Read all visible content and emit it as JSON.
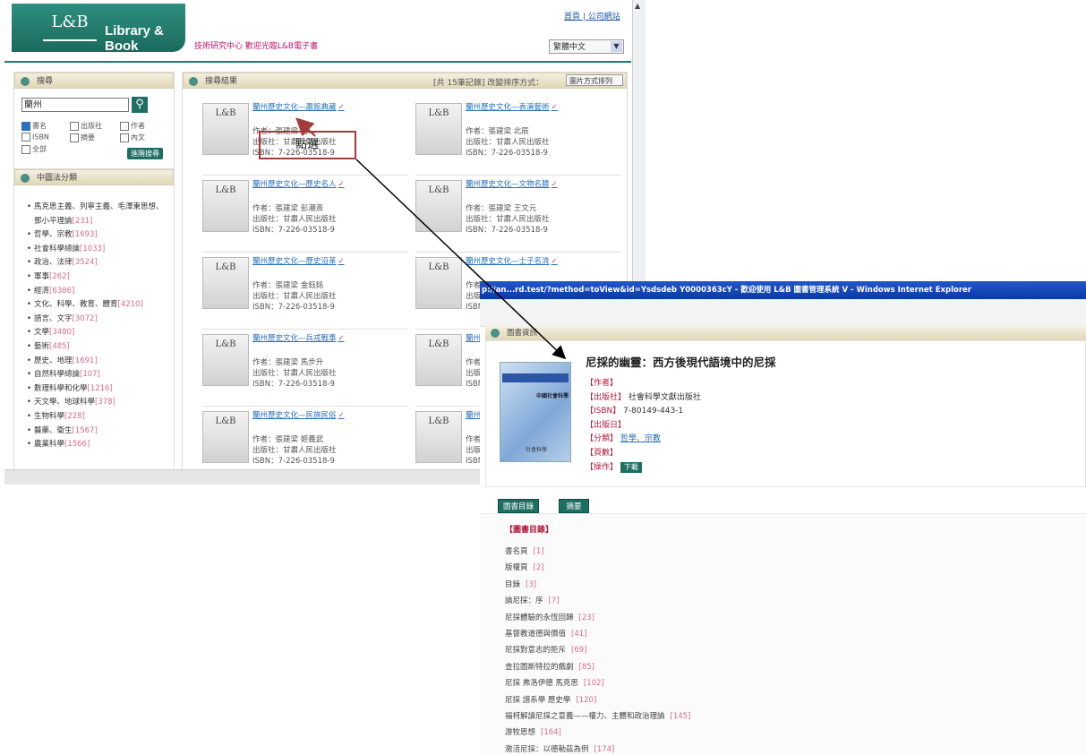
{
  "header": {
    "logo_mark": "L&B",
    "logo_text": "Library & Book",
    "slogan": "技術研究中心 歡迎光臨L&B電子書",
    "top_links": "首頁 | 公司網站",
    "language_selected": "繁體中文"
  },
  "search": {
    "title": "搜尋",
    "input_value": "蘭州",
    "options": [
      "書名",
      "出版社",
      "作者",
      "ISBN",
      "摘要",
      "內文",
      "全部"
    ],
    "advanced_label": "進階搜尋"
  },
  "categories": {
    "title": "中圖法分類",
    "items": [
      {
        "name": "馬克思主義、列寧主義、毛澤東思想、鄧小平理論",
        "count": "[231]"
      },
      {
        "name": "哲學、宗教",
        "count": "[1693]"
      },
      {
        "name": "社會科學總論",
        "count": "[1033]"
      },
      {
        "name": "政治、法律",
        "count": "[3524]"
      },
      {
        "name": "軍事",
        "count": "[262]"
      },
      {
        "name": "經濟",
        "count": "[6386]"
      },
      {
        "name": "文化、科學、教育、體育",
        "count": "[4210]"
      },
      {
        "name": "語言、文字",
        "count": "[3072]"
      },
      {
        "name": "文學",
        "count": "[3480]"
      },
      {
        "name": "藝術",
        "count": "[485]"
      },
      {
        "name": "歷史、地理",
        "count": "[1691]"
      },
      {
        "name": "自然科學總論",
        "count": "[107]"
      },
      {
        "name": "數理科學和化學",
        "count": "[1216]"
      },
      {
        "name": "天文學、地球科學",
        "count": "[378]"
      },
      {
        "name": "生物科學",
        "count": "[228]"
      },
      {
        "name": "醫藥、衛生",
        "count": "[1567]"
      },
      {
        "name": "農業科學",
        "count": "[1566]"
      }
    ]
  },
  "results": {
    "title": "搜尋結果",
    "sort_info": "[共 15筆記錄] 改變排序方式：",
    "sort_selected": "圖片方式排列",
    "books": [
      {
        "cover": "L&B",
        "title": "蘭州歷史文化—蕭館典藏",
        "author": "作者：張建梁 趙...",
        "publisher": "出版社：甘肅人民出版社",
        "isbn": "ISBN：7-226-03518-9"
      },
      {
        "cover": "L&B",
        "title": "蘭州歷史文化—表演藝術",
        "author": "作者：張建梁 北辰",
        "publisher": "出版社：甘肅人民出版社",
        "isbn": "ISBN：7-226-03518-9"
      },
      {
        "cover": "L&B",
        "title": "蘭州歷史文化—歷史名人",
        "author": "作者：張建梁 彭潮斎",
        "publisher": "出版社：甘肅人民出版社",
        "isbn": "ISBN：7-226-03518-9"
      },
      {
        "cover": "L&B",
        "title": "蘭州歷史文化—文物名勝",
        "author": "作者：張建梁 王文元",
        "publisher": "出版社：甘肅人民出版社",
        "isbn": "ISBN：7-226-03518-9"
      },
      {
        "cover": "L&B",
        "title": "蘭州歷史文化—歷史沿革",
        "author": "作者：張建梁 金鈺銘",
        "publisher": "出版社：甘肅人民出版社",
        "isbn": "ISBN：7-226-03518-9"
      },
      {
        "cover": "L&B",
        "title": "蘭州歷史文化—士子名流",
        "author": "作者",
        "publisher": "出版",
        "isbn": "ISBN"
      },
      {
        "cover": "L&B",
        "title": "蘭州歷史文化—兵戎戰事",
        "author": "作者：張建梁 馬步升",
        "publisher": "出版社：甘肅人民出版社",
        "isbn": "ISBN：7-226-03518-9"
      },
      {
        "cover": "L&B",
        "title": "蘭州",
        "author": "作者",
        "publisher": "出版",
        "isbn": "ISBN"
      },
      {
        "cover": "L&B",
        "title": "蘭州歷史文化—民族民俗",
        "author": "作者：張建梁 姬義武",
        "publisher": "出版社：甘肅人民出版社",
        "isbn": "ISBN：7-226-03518-9"
      },
      {
        "cover": "L&B",
        "title": "蘭州",
        "author": "作者",
        "publisher": "出版",
        "isbn": "ISBN"
      }
    ]
  },
  "annotation": {
    "label": "點選"
  },
  "popup": {
    "window_title": "p://an...rd.test/?method=toView&id=Ysdsdeb Y0000363cY - 歡迎使用 L&B 圖書管理系統 V - Windows Internet Explorer",
    "section_title": "圖書資訊",
    "book_title": "尼採的幽靈：西方後現代語境中的尼採",
    "cover_series": "中國社會科學",
    "cover_publisher": "社會科學",
    "fields": {
      "author_label": "【作者】",
      "publisher_label": "【出版社】",
      "publisher_value": "社會科學文獻出版社",
      "isbn_label": "【ISBN】",
      "isbn_value": "7-80149-443-1",
      "date_label": "【出版日】",
      "category_label": "【分類】",
      "category_value": "哲學、宗教",
      "pages_label": "【頁數】",
      "action_label": "【操作】",
      "download_label": "下載"
    },
    "tabs": [
      "圖書目錄",
      "摘要"
    ],
    "toc_title": "【圖書目錄】",
    "toc": [
      {
        "name": "書名頁",
        "page": "[1]"
      },
      {
        "name": "版權頁",
        "page": "[2]"
      },
      {
        "name": "目錄",
        "page": "[3]"
      },
      {
        "name": "論尼採：序",
        "page": "[7]"
      },
      {
        "name": "尼採體驗的永恆回歸",
        "page": "[23]"
      },
      {
        "name": "基督教道德與價值",
        "page": "[41]"
      },
      {
        "name": "尼採對意志的拒斥",
        "page": "[69]"
      },
      {
        "name": "查拉圖斯特拉的戲劇",
        "page": "[85]"
      },
      {
        "name": "尼採 弗洛伊德 馬克思",
        "page": "[102]"
      },
      {
        "name": "尼採 譜系學 歷史學",
        "page": "[120]"
      },
      {
        "name": "福柯解讀尼採之意義——權力、主體和政治理論",
        "page": "[145]"
      },
      {
        "name": "游牧思想",
        "page": "[164]"
      },
      {
        "name": "激活尼採：以德勒茲為例",
        "page": "[174]"
      }
    ]
  }
}
